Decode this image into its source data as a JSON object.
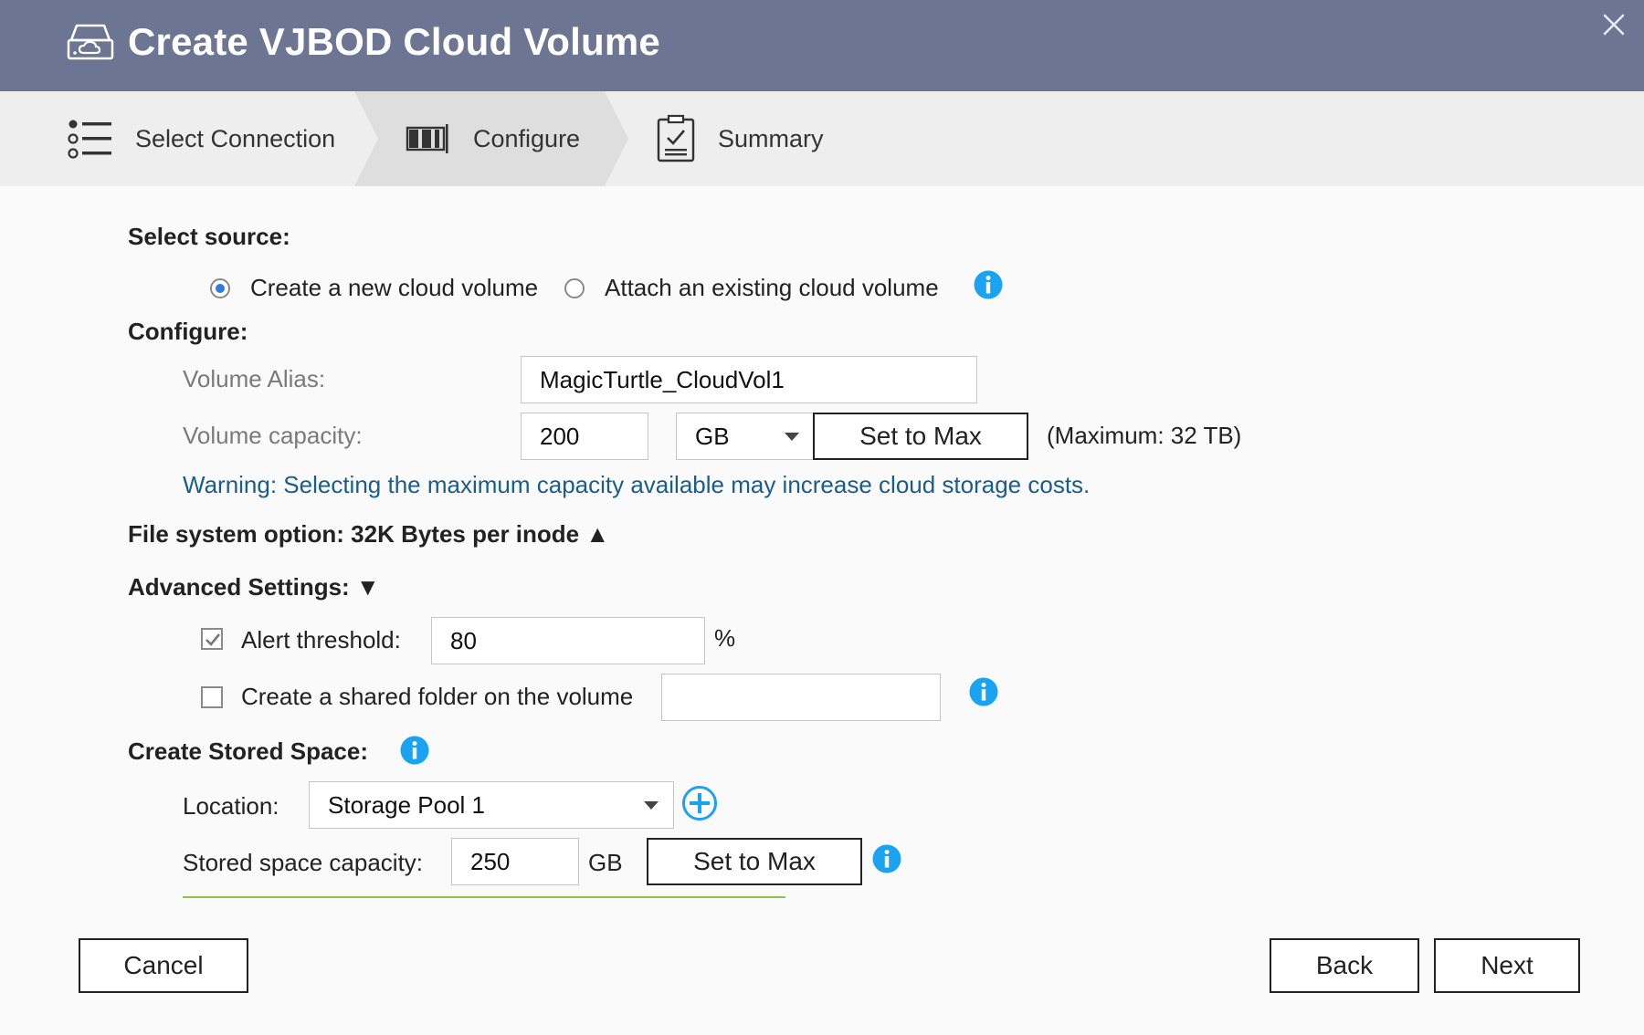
{
  "window": {
    "title": "Create VJBOD Cloud Volume",
    "app_icon": "cloud-drive-icon",
    "close_icon": "close-icon"
  },
  "steps": [
    {
      "label": "Select Connection",
      "icon": "list-icon",
      "active": false
    },
    {
      "label": "Configure",
      "icon": "configure-icon",
      "active": true
    },
    {
      "label": "Summary",
      "icon": "clipboard-check-icon",
      "active": false
    }
  ],
  "source": {
    "heading": "Select source:",
    "options": [
      {
        "label": "Create a new cloud volume",
        "selected": true
      },
      {
        "label": "Attach an existing cloud volume",
        "selected": false
      }
    ]
  },
  "configure": {
    "heading": "Configure:",
    "alias_label": "Volume Alias:",
    "alias_value": "MagicTurtle_CloudVol1",
    "capacity_label": "Volume capacity:",
    "capacity_value": "200",
    "capacity_unit": "GB",
    "set_max_label": "Set to Max",
    "maximum_text": "(Maximum: 32 TB)",
    "warning": "Warning: Selecting the maximum capacity available may increase cloud storage costs."
  },
  "file_system": {
    "label": "File system option: 32K Bytes per inode ▲"
  },
  "advanced": {
    "heading": "Advanced Settings: ▼",
    "alert_label": "Alert threshold:",
    "alert_checked": true,
    "alert_value": "80",
    "alert_unit": "%",
    "shared_label": "Create a shared folder on the volume",
    "shared_checked": false,
    "shared_value": ""
  },
  "stored_space": {
    "heading": "Create Stored Space:",
    "location_label": "Location:",
    "location_value": "Storage Pool 1",
    "capacity_label": "Stored space capacity:",
    "capacity_value": "250",
    "capacity_unit": "GB",
    "set_max_label": "Set to Max"
  },
  "footer": {
    "cancel": "Cancel",
    "back": "Back",
    "next": "Next"
  },
  "colors": {
    "titlebar": "#6c7693",
    "info_blue": "#1aa3f0",
    "warning_text": "#1b5d8a",
    "progress": "#8bc34a"
  }
}
